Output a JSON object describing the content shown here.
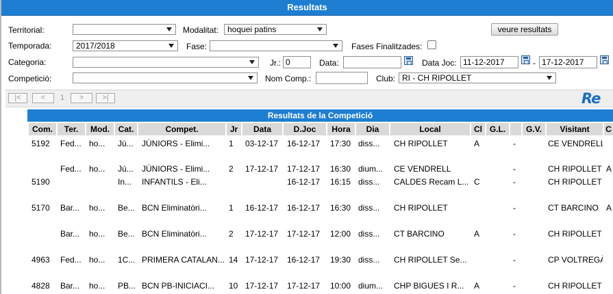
{
  "title": "Resultats",
  "filters": {
    "territorial_label": "Territorial:",
    "territorial_value": "",
    "modalitat_label": "Modalitat:",
    "modalitat_value": "hoquei patins",
    "veure_button": "veure resultats",
    "temporada_label": "Temporada:",
    "temporada_value": "2017/2018",
    "fase_label": "Fase:",
    "fase_value": "",
    "fases_finalitzades_label": "Fases Finalitzades:",
    "categoria_label": "Categoria:",
    "categoria_value": "",
    "jr_label": "Jr.:",
    "jr_value": "0",
    "data_label": "Data:",
    "data_value": "",
    "datajoc_label": "Data Joc:",
    "datajoc_from": "11-12-2017",
    "datajoc_sep": "-",
    "datajoc_to": "17-12-2017",
    "competicio_label": "Competició:",
    "competicio_value": "",
    "nomcomp_label": "Nom Comp.:",
    "nomcomp_value": "",
    "club_label": "Club:",
    "club_value": "RI - CH RIPOLLET"
  },
  "pager": {
    "first": "|<",
    "prev": "<",
    "page": "1",
    "next": ">",
    "last": ">|"
  },
  "logo_text": "Re",
  "competition_title": "Resultats de la Competició",
  "columns": [
    "Com.",
    "Ter.",
    "Mod.",
    "Cat.",
    "Compet.",
    "Jr",
    "Data",
    "D.Joc",
    "Hora",
    "Dia",
    "Local",
    "Cl",
    "G.L.",
    "",
    "G.V.",
    "Visitant",
    "C"
  ],
  "rows": [
    [
      "5192",
      "Fed...",
      "ho...",
      "Jú...",
      "JÚNIORS - Elimi...",
      "1",
      "03-12-17",
      "16-12-17",
      "17:30",
      "diss...",
      "CH RIPOLLET",
      "A",
      "",
      "-",
      "",
      "CE VENDRELL",
      ""
    ],
    [
      "",
      "Fed...",
      "ho...",
      "Jú...",
      "JÚNIORS - Elimi...",
      "2",
      "17-12-17",
      "17-12-17",
      "16:30",
      "dium...",
      "CE VENDRELL",
      "",
      "",
      "-",
      "",
      "CH RIPOLLET",
      "A"
    ],
    [
      "5190",
      "",
      "",
      "In...",
      "INFANTILS - Eli...",
      "",
      "",
      "16-12-17",
      "16:15",
      "diss...",
      "CALDES Recam L...",
      "C",
      "",
      "-",
      "",
      "CH RIPOLLET",
      ""
    ],
    [
      "5170",
      "Bar...",
      "ho...",
      "Be...",
      "BCN Eliminatòri...",
      "1",
      "16-12-17",
      "16-12-17",
      "16:30",
      "diss...",
      "CH RIPOLLET",
      "",
      "",
      "-",
      "",
      "CT BARCINO",
      "A"
    ],
    [
      "",
      "Bar...",
      "ho...",
      "Be...",
      "BCN Eliminatòri...",
      "2",
      "17-12-17",
      "17-12-17",
      "12:00",
      "diss...",
      "CT BARCINO",
      "A",
      "",
      "-",
      "",
      "CH RIPOLLET",
      ""
    ],
    [
      "4963",
      "Fed...",
      "ho...",
      "1C...",
      "PRIMERA CATALAN...",
      "14",
      "17-12-17",
      "16-12-17",
      "19:30",
      "diss...",
      "CH RIPOLLET Se...",
      "",
      "",
      "-",
      "",
      "CP VOLTREGÀ",
      ""
    ],
    [
      "4828",
      "Bar...",
      "ho...",
      "PB...",
      "BCN PB-INICIACI...",
      "10",
      "17-12-17",
      "17-12-17",
      "10:00",
      "dium...",
      "CHP BIGUES I R...",
      "A",
      "",
      "-",
      "",
      "CH RIPOLLET",
      ""
    ]
  ]
}
